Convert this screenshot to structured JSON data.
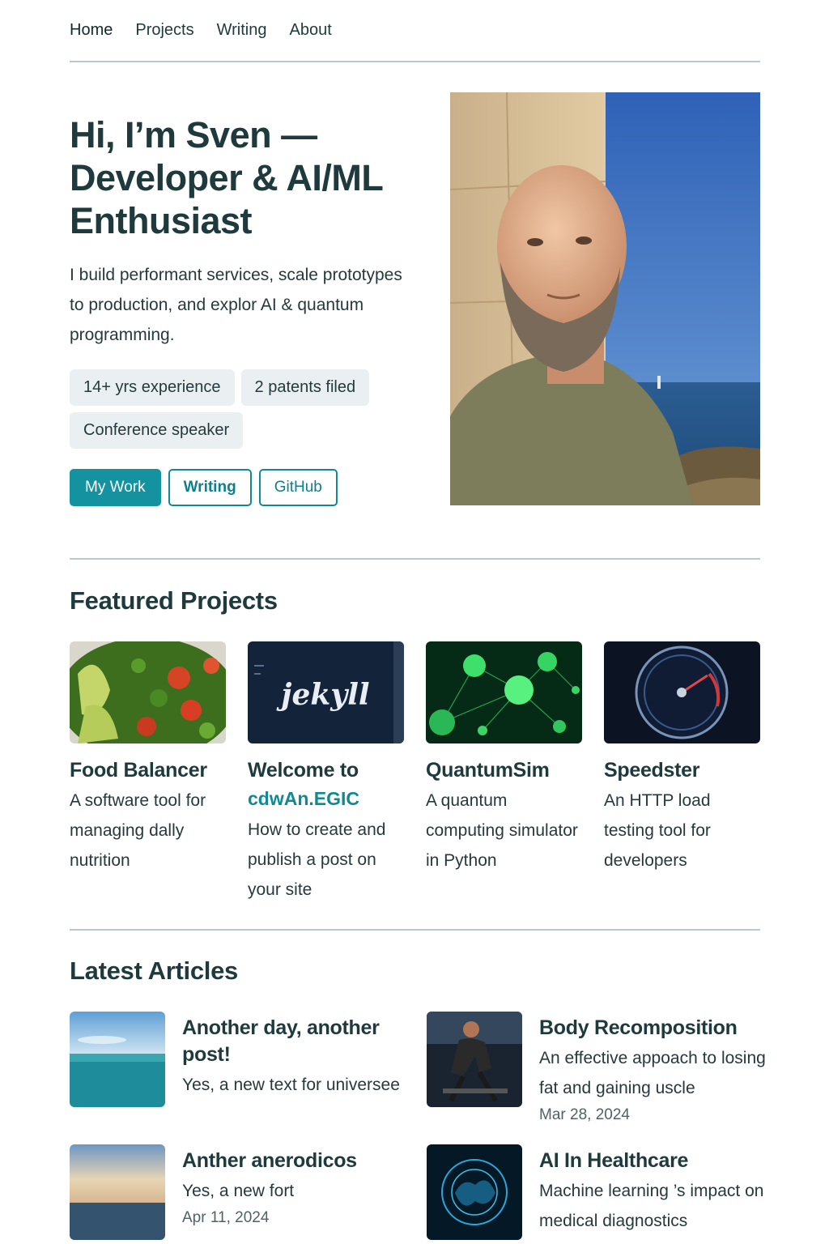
{
  "nav": {
    "items": [
      "Home",
      "Projects",
      "Writing",
      "About"
    ]
  },
  "hero": {
    "title_line1": "Hi, I’m Sven —",
    "title_line2": "Developer & AI/ML",
    "title_line3": "Enthusiast",
    "subtitle": "I build performant services, scale prototypes to production, and explor AI & quantum programming.",
    "badges": [
      "14+ yrs experience",
      "2 patents filed",
      "Conference speaker"
    ],
    "buttons": {
      "my_work": "My Work",
      "writing": "Writing",
      "github": "GitHub"
    }
  },
  "featured": {
    "title": "Featured Projects",
    "projects": [
      {
        "title": "Food Balancer",
        "desc": "A software tool for managing dally nutrition"
      },
      {
        "title": "Welcome to",
        "accent": "cdwAn.EGIC",
        "desc": "How to create and publish a post on your site",
        "image_text": "jekyll"
      },
      {
        "title": "QuantumSim",
        "desc": "A quantum computing simulator in Python"
      },
      {
        "title": "Speedster",
        "desc": "An HTTP load testing tool for developers"
      }
    ]
  },
  "articles": {
    "title": "Latest Articles",
    "items": [
      {
        "title": "Another day, another post!",
        "desc": "Yes, a new text for universee",
        "date": ""
      },
      {
        "title": "Body Recomposition",
        "desc": "An effective appoach to losing fat and gaining uscle",
        "date": "Mar 28, 2024"
      },
      {
        "title": "Anther anerodicos",
        "desc": "Yes, a new fort",
        "date": "Apr 11, 2024"
      },
      {
        "title": "AI In Healthcare",
        "desc": "Machine learning ’s impact on medical diagnostics",
        "date": ""
      }
    ]
  },
  "colors": {
    "accent": "#1592a0",
    "text": "#1f3a3d",
    "divider": "#b9c9cd",
    "badge_bg": "#eaeff1"
  }
}
